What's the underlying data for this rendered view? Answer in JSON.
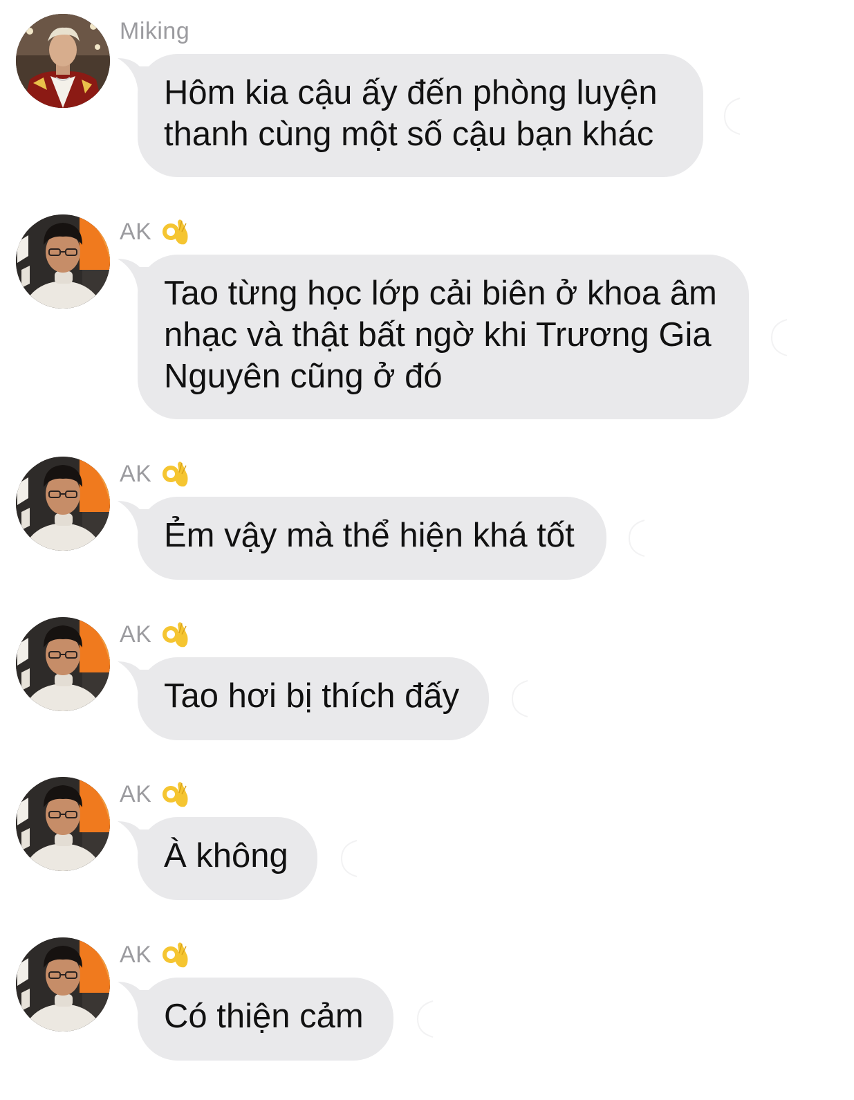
{
  "colors": {
    "bubble": "#e9e9eb",
    "sender_name": "#9b9b9f",
    "text": "#111111",
    "background": "#ffffff"
  },
  "messages": [
    {
      "sender": "Miking",
      "avatar": "miking-avatar",
      "text": "Hôm kia cậu ấy đến phòng luyện thanh cùng một số cậu bạn khác",
      "reaction_emoji": ""
    },
    {
      "sender": "AK",
      "avatar": "ak-avatar",
      "name_emoji": "ok-hand-emoji",
      "text": "Tao từng học lớp cải biên ở khoa âm nhạc và thật bất ngờ khi Trương Gia Nguyên cũng ở đó"
    },
    {
      "sender": "AK",
      "avatar": "ak-avatar",
      "name_emoji": "ok-hand-emoji",
      "text": "Ẻm vậy mà thể hiện khá tốt"
    },
    {
      "sender": "AK",
      "avatar": "ak-avatar",
      "name_emoji": "ok-hand-emoji",
      "text": "Tao hơi bị thích đấy"
    },
    {
      "sender": "AK",
      "avatar": "ak-avatar",
      "name_emoji": "ok-hand-emoji",
      "text": "À không"
    },
    {
      "sender": "AK",
      "avatar": "ak-avatar",
      "name_emoji": "ok-hand-emoji",
      "text": "Có thiện cảm"
    }
  ]
}
